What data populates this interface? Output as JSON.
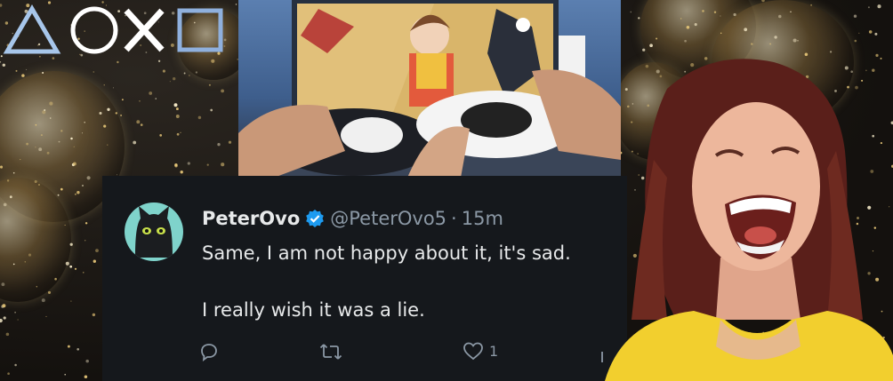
{
  "logo": {
    "symbols": [
      "triangle",
      "circle",
      "cross",
      "square"
    ],
    "color": "#a7c6ea"
  },
  "tweet": {
    "display_name": "PeterOvo",
    "handle": "@PeterOvo5",
    "separator": "·",
    "time": "15m",
    "text_line_1": "Same, I am not happy about it, it's sad.",
    "text_line_2": "I really wish it was a lie.",
    "actions": {
      "reply_icon": "reply-icon",
      "retweet_icon": "retweet-icon",
      "like_icon": "heart-icon",
      "like_count": "1"
    },
    "colors": {
      "background": "#15181c",
      "text": "#e7e9ea",
      "muted": "#8b98a5",
      "verified": "#1d9bf0"
    }
  },
  "images": {
    "game_photo": "hands holding PS5 controllers in front of anime game screen",
    "avatar": "black cat on teal background",
    "woman": "laughing woman in yellow top",
    "background": "gold balloons and sparkles"
  }
}
